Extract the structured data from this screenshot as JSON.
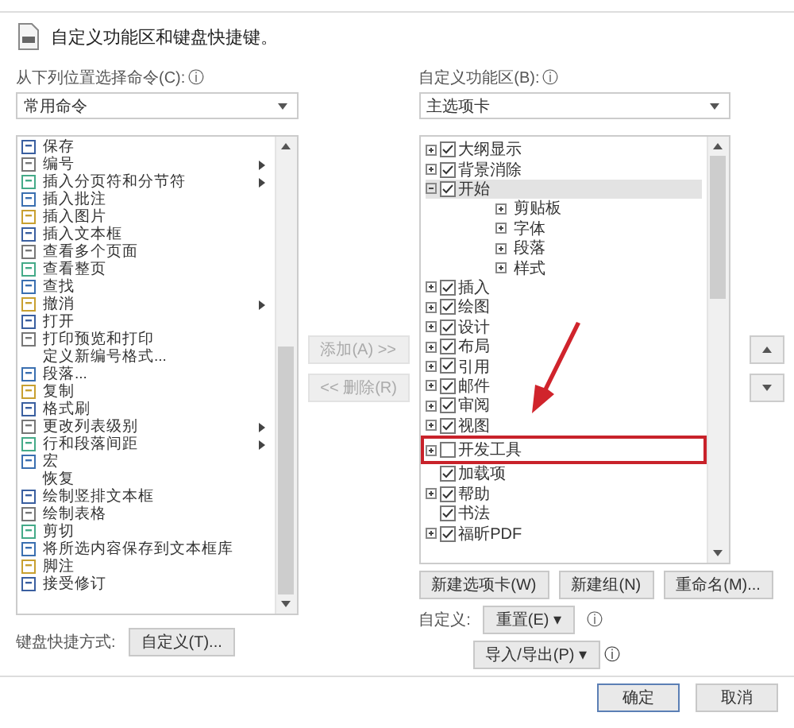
{
  "header": {
    "title": "自定义功能区和键盘快捷键。"
  },
  "commands": {
    "label": "从下列位置选择命令(C):",
    "info": "ⓘ",
    "dropdown": "常用命令",
    "items": [
      {
        "label": "保存",
        "kind": "icon",
        "submenu": false
      },
      {
        "label": "编号",
        "kind": "icon",
        "submenu": true
      },
      {
        "label": "插入分页符和分节符",
        "kind": "icon",
        "submenu": true
      },
      {
        "label": "插入批注",
        "kind": "icon",
        "submenu": false
      },
      {
        "label": "插入图片",
        "kind": "icon",
        "submenu": false
      },
      {
        "label": "插入文本框",
        "kind": "icon",
        "submenu": false
      },
      {
        "label": "查看多个页面",
        "kind": "icon",
        "submenu": false
      },
      {
        "label": "查看整页",
        "kind": "icon",
        "submenu": false
      },
      {
        "label": "查找",
        "kind": "icon",
        "submenu": false
      },
      {
        "label": "撤消",
        "kind": "icon",
        "submenu": true
      },
      {
        "label": "打开",
        "kind": "icon",
        "submenu": false
      },
      {
        "label": "打印预览和打印",
        "kind": "icon",
        "submenu": false
      },
      {
        "label": "定义新编号格式...",
        "kind": "plain",
        "submenu": false
      },
      {
        "label": "段落...",
        "kind": "icon",
        "submenu": false
      },
      {
        "label": "复制",
        "kind": "icon",
        "submenu": false
      },
      {
        "label": "格式刷",
        "kind": "icon",
        "submenu": false
      },
      {
        "label": "更改列表级别",
        "kind": "icon",
        "submenu": true
      },
      {
        "label": "行和段落间距",
        "kind": "icon",
        "submenu": true
      },
      {
        "label": "宏",
        "kind": "icon",
        "submenu": false
      },
      {
        "label": "恢复",
        "kind": "plain",
        "submenu": false
      },
      {
        "label": "绘制竖排文本框",
        "kind": "icon",
        "submenu": false
      },
      {
        "label": "绘制表格",
        "kind": "icon",
        "submenu": false
      },
      {
        "label": "剪切",
        "kind": "icon",
        "submenu": false
      },
      {
        "label": "将所选内容保存到文本框库",
        "kind": "icon",
        "submenu": false
      },
      {
        "label": "脚注",
        "kind": "icon",
        "submenu": false
      },
      {
        "label": "接受修订",
        "kind": "icon",
        "submenu": false
      }
    ]
  },
  "shortcuts": {
    "label": "键盘快捷方式:",
    "button": "自定义(T)..."
  },
  "move_buttons": [
    {
      "label": "添加(A) >>",
      "disabled": true
    },
    {
      "label": "<< 删除(R)",
      "disabled": true
    }
  ],
  "ribbon": {
    "label": "自定义功能区(B):",
    "info": "ⓘ",
    "dropdown": "主选项卡",
    "tabs": [
      {
        "label": "大纲显示",
        "kind": "expandable",
        "expanded": false,
        "checked": true,
        "selected": false,
        "highlighted": false
      },
      {
        "label": "背景消除",
        "kind": "expandable",
        "expanded": false,
        "checked": true,
        "selected": false,
        "highlighted": false
      },
      {
        "label": "开始",
        "kind": "expandable",
        "expanded": true,
        "checked": true,
        "selected": true,
        "highlighted": false,
        "children": [
          {
            "label": "剪贴板",
            "selected": false
          },
          {
            "label": "字体",
            "selected": false
          },
          {
            "label": "段落",
            "selected": false
          },
          {
            "label": "样式",
            "selected": false
          }
        ]
      },
      {
        "label": "插入",
        "kind": "expandable",
        "expanded": false,
        "checked": true,
        "selected": false,
        "highlighted": false
      },
      {
        "label": "绘图",
        "kind": "expandable",
        "expanded": false,
        "checked": true,
        "selected": false,
        "highlighted": false
      },
      {
        "label": "设计",
        "kind": "expandable",
        "expanded": false,
        "checked": true,
        "selected": false,
        "highlighted": false
      },
      {
        "label": "布局",
        "kind": "expandable",
        "expanded": false,
        "checked": true,
        "selected": false,
        "highlighted": false
      },
      {
        "label": "引用",
        "kind": "expandable",
        "expanded": false,
        "checked": true,
        "selected": false,
        "highlighted": false
      },
      {
        "label": "邮件",
        "kind": "expandable",
        "expanded": false,
        "checked": true,
        "selected": false,
        "highlighted": false
      },
      {
        "label": "审阅",
        "kind": "expandable",
        "expanded": false,
        "checked": true,
        "selected": false,
        "highlighted": false
      },
      {
        "label": "视图",
        "kind": "expandable",
        "expanded": false,
        "checked": true,
        "selected": false,
        "highlighted": false
      },
      {
        "label": "开发工具",
        "kind": "expandable",
        "expanded": false,
        "checked": false,
        "selected": false,
        "highlighted": true
      },
      {
        "label": "加载项",
        "kind": "leaf",
        "checked": true,
        "selected": false,
        "highlighted": false
      },
      {
        "label": "帮助",
        "kind": "expandable",
        "expanded": false,
        "checked": true,
        "selected": false,
        "highlighted": false
      },
      {
        "label": "书法",
        "kind": "leaf",
        "checked": true,
        "selected": false,
        "highlighted": false
      },
      {
        "label": "福昕PDF",
        "kind": "expandable",
        "expanded": false,
        "checked": true,
        "selected": false,
        "highlighted": false
      }
    ],
    "buttons": [
      "新建选项卡(W)",
      "新建组(N)",
      "重命名(M)..."
    ],
    "customize_label": "自定义:",
    "reset_button": "重置(E) ▾",
    "import_export_button": "导入/导出(P) ▾"
  },
  "footer": {
    "buttons": [
      "确定",
      "取消"
    ]
  }
}
